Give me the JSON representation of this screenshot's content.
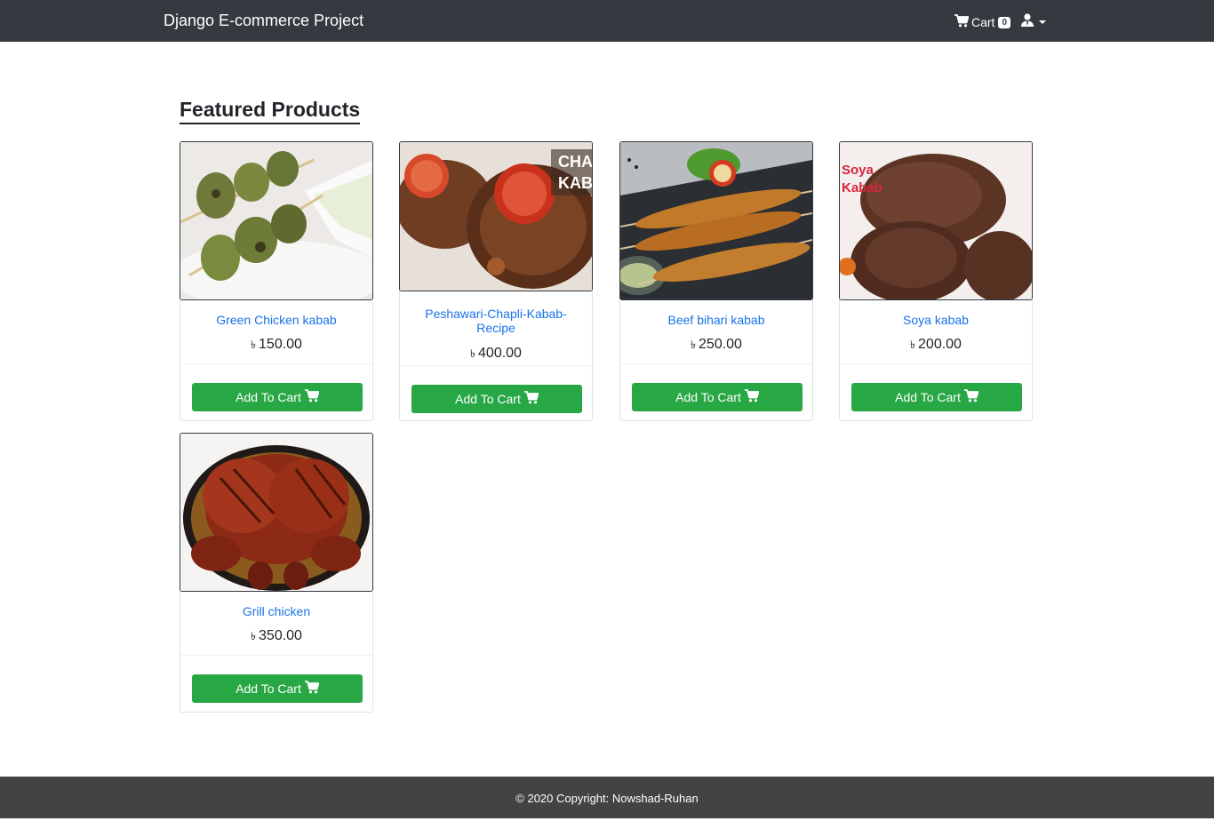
{
  "navbar": {
    "brand": "Django E-commerce Project",
    "cart_label": "Cart",
    "cart_count": "0"
  },
  "main": {
    "title": "Featured Products",
    "currency_symbol": "৳",
    "products": [
      {
        "name": "Green Chicken kabab",
        "price": "150.00",
        "button": "Add To Cart"
      },
      {
        "name": "Peshawari-Chapli-Kabab-Recipe",
        "price": "400.00",
        "button": "Add To Cart",
        "image_text": "CHAPLI KABAB"
      },
      {
        "name": "Beef bihari kabab",
        "price": "250.00",
        "button": "Add To Cart"
      },
      {
        "name": "Soya kabab",
        "price": "200.00",
        "button": "Add To Cart",
        "image_text": "Soya Kabab"
      },
      {
        "name": "Grill chicken",
        "price": "350.00",
        "button": "Add To Cart"
      }
    ]
  },
  "footer": {
    "text": "© 2020 Copyright: Nowshad-Ruhan"
  },
  "colors": {
    "navbar": "#343a40",
    "button": "#28a745",
    "link": "#1a73e8",
    "footer": "#424342"
  }
}
